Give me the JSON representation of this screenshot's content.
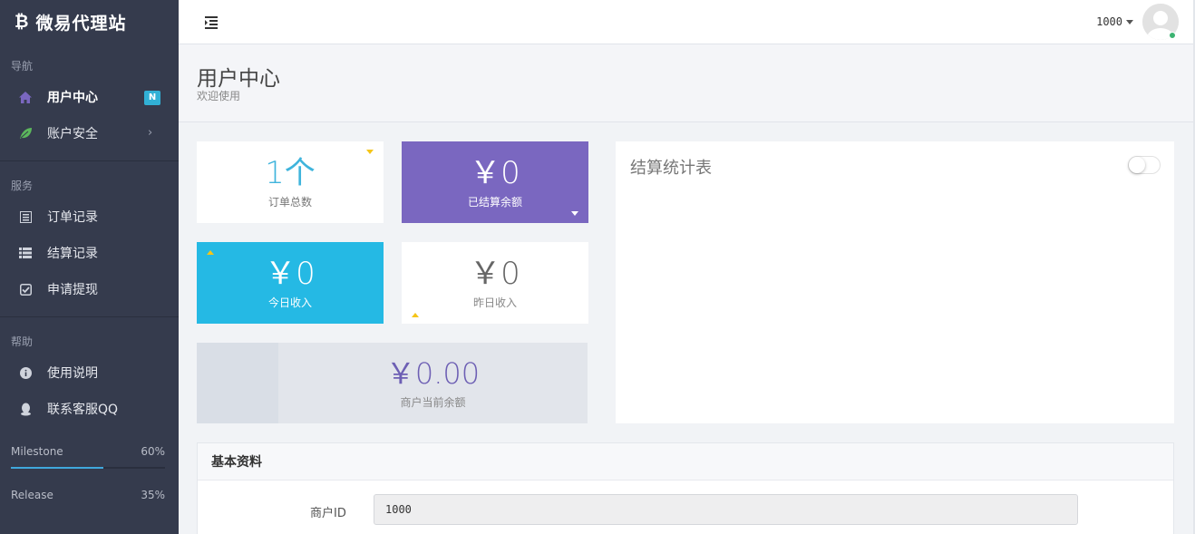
{
  "brand": {
    "icon": "bitcoin-icon",
    "title": "微易代理站"
  },
  "sidebar": {
    "sections": [
      {
        "label": "导航",
        "items": [
          {
            "label": "用户中心",
            "icon": "home-icon",
            "badge": "N",
            "active": true
          },
          {
            "label": "账户安全",
            "icon": "leaf-icon",
            "chevron": "›"
          }
        ]
      },
      {
        "label": "服务",
        "items": [
          {
            "label": "订单记录",
            "icon": "list-alt-icon"
          },
          {
            "label": "结算记录",
            "icon": "th-list-icon"
          },
          {
            "label": "申请提现",
            "icon": "check-square-icon"
          }
        ]
      },
      {
        "label": "帮助",
        "items": [
          {
            "label": "使用说明",
            "icon": "info-circle-icon"
          },
          {
            "label": "联系客服QQ",
            "icon": "qq-icon"
          }
        ]
      }
    ],
    "progress": [
      {
        "label": "Milestone",
        "value": "60%",
        "fraction": 0.6
      },
      {
        "label": "Release",
        "value": "35%",
        "fraction": 0.35
      }
    ]
  },
  "topbar": {
    "user_id": "1000",
    "menu_icon": "indent-icon",
    "avatar_icon": "user-avatar-icon"
  },
  "page": {
    "title": "用户中心",
    "subtitle": "欢迎使用"
  },
  "stats": {
    "orders": {
      "value": "1个",
      "label": "订单总数"
    },
    "settled": {
      "value": "￥0",
      "label": "已结算余额"
    },
    "today": {
      "value": "￥0",
      "label": "今日收入"
    },
    "yesterday": {
      "value": "￥0",
      "label": "昨日收入"
    },
    "balance": {
      "value": "￥0.00",
      "label": "商户当前余额"
    }
  },
  "chart_panel": {
    "title": "结算统计表",
    "toggle_on": false
  },
  "info": {
    "title": "基本资料",
    "merchant_id_label": "商户ID",
    "merchant_id_value": "1000"
  },
  "colors": {
    "sidebar_bg": "#353b4d",
    "purple_card": "#7a67c0",
    "cyan_card": "#25b9e4",
    "accent_blue": "#3fb4dc",
    "progress_fill": "#3fa7dc",
    "badge": "#31b0d5",
    "online": "#3cb371",
    "arrow_yellow": "#f5c518"
  }
}
